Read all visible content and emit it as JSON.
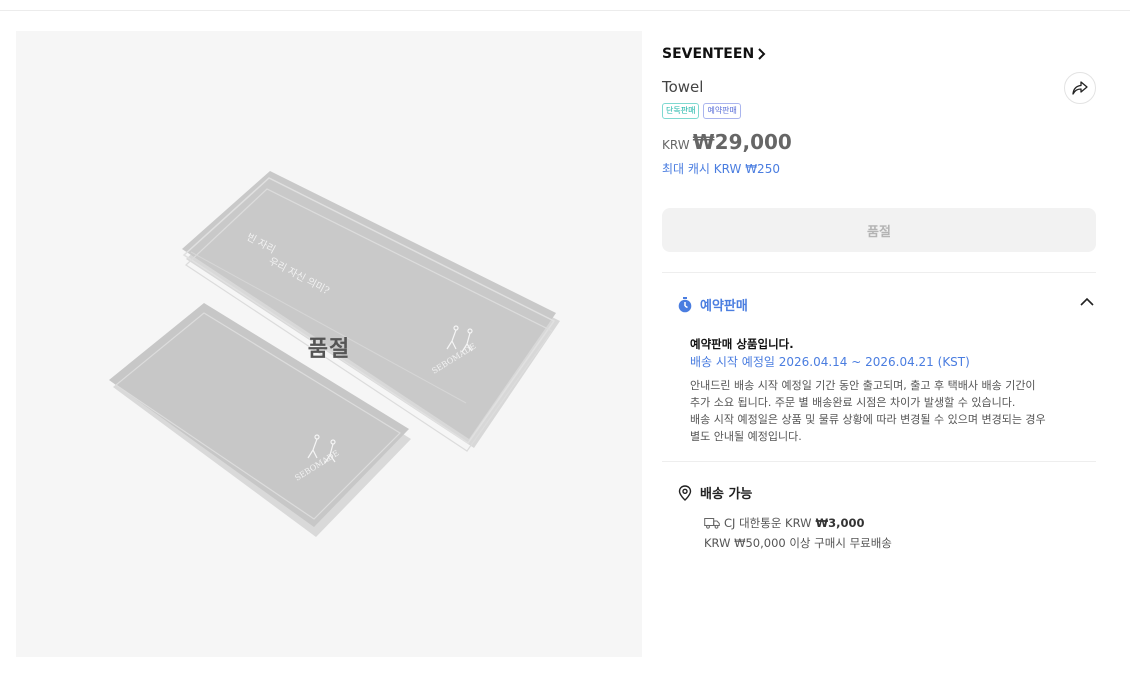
{
  "product_image": {
    "overlay_text": "품절",
    "towel_text_top_line1": "빈 자리",
    "towel_text_top_line2": "우리 자신 의미?",
    "towel_logo": "SEBOMADE"
  },
  "artist": {
    "name": "SEVENTEEN"
  },
  "product": {
    "name": "Towel",
    "badges": [
      "단독판매",
      "예약판매"
    ],
    "currency": "KRW",
    "price": "₩29,000",
    "cash_back": "최대 캐시 KRW ₩250"
  },
  "buy_button": {
    "label": "품절"
  },
  "preorder": {
    "title": "예약판매",
    "notice": "예약판매 상품입니다.",
    "ship_dates": "배송 시작 예정일 2026.04.14 ~ 2026.04.21 (KST)",
    "description": [
      "안내드린 배송 시작 예정일 기간 동안 출고되며, 출고 후 택배사 배송 기간이",
      "추가 소요 됩니다. 주문 별 배송완료 시점은 차이가 발생할 수 있습니다.",
      "배송 시작 예정일은 상품 및 물류 상황에 따라 변경될 수 있으며 변경되는 경우",
      "별도 안내될 예정입니다."
    ]
  },
  "delivery": {
    "title": "배송 가능",
    "carrier": "CJ 대한통운 KRW",
    "fee": "₩3,000",
    "free_shipping": "KRW ₩50,000 이상 구매시 무료배송"
  },
  "colors": {
    "accent_blue": "#4a7de0",
    "badge_teal": "#16b3a6",
    "badge_blue": "#5b6fd8",
    "soldout_button_bg": "#f2f2f2"
  },
  "icons": [
    "chevron-right-icon",
    "share-icon",
    "timer-icon",
    "chevron-up-icon",
    "location-pin-icon",
    "truck-icon"
  ]
}
